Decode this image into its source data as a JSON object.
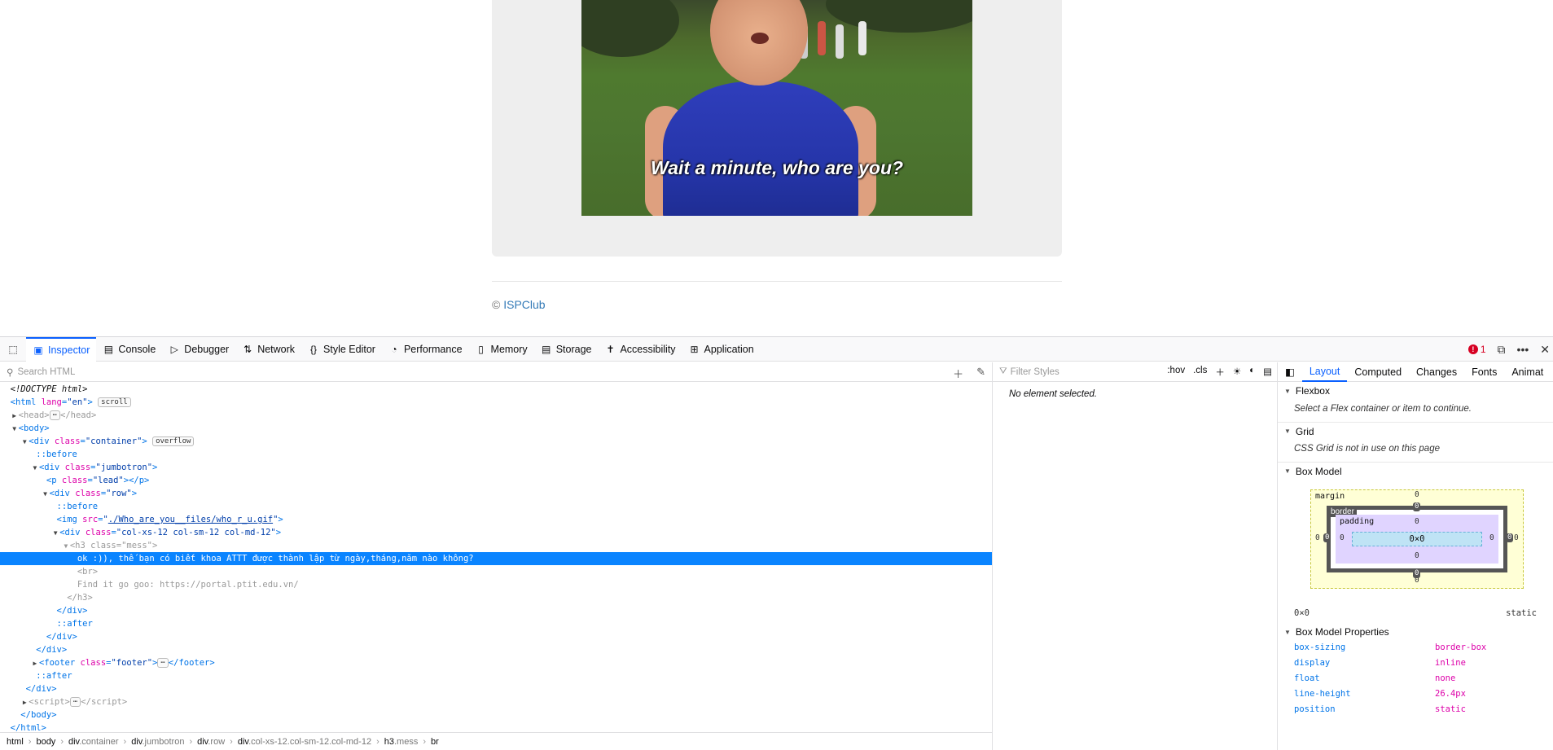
{
  "page": {
    "caption": "Wait a minute, who are you?",
    "footer_copy": "©",
    "footer_link": "ISPClub"
  },
  "devtools": {
    "tabs": [
      {
        "label": "Inspector",
        "icon": "inspector-icon"
      },
      {
        "label": "Console",
        "icon": "console-icon"
      },
      {
        "label": "Debugger",
        "icon": "debugger-icon"
      },
      {
        "label": "Network",
        "icon": "network-icon"
      },
      {
        "label": "Style Editor",
        "icon": "style-editor-icon"
      },
      {
        "label": "Performance",
        "icon": "performance-icon"
      },
      {
        "label": "Memory",
        "icon": "memory-icon"
      },
      {
        "label": "Storage",
        "icon": "storage-icon"
      },
      {
        "label": "Accessibility",
        "icon": "accessibility-icon"
      },
      {
        "label": "Application",
        "icon": "application-icon"
      }
    ],
    "error_count": "1",
    "search_placeholder": "Search HTML",
    "tree": {
      "doctype": "<!DOCTYPE html>",
      "html_lang": "\"en\"",
      "scroll_badge": "scroll",
      "overflow_badge": "overflow",
      "img_src": "./Who_are_you__files/who_r_u.gif",
      "h3_class": "\"mess\"",
      "selected_text": "ok :)), thế bạn có biết khoa ATTT được thành lập từ ngày,tháng,năm nào không?",
      "br": "<br>",
      "hint_text": "Find it go goo: https://portal.ptit.edu.vn/"
    },
    "breadcrumbs": [
      {
        "tag": "html",
        "cls": ""
      },
      {
        "tag": "body",
        "cls": ""
      },
      {
        "tag": "div",
        "cls": ".container"
      },
      {
        "tag": "div",
        "cls": ".jumbotron"
      },
      {
        "tag": "div",
        "cls": ".row"
      },
      {
        "tag": "div",
        "cls": ".col-xs-12.col-sm-12.col-md-12"
      },
      {
        "tag": "h3",
        "cls": ".mess"
      },
      {
        "tag": "br",
        "cls": ""
      }
    ],
    "rules": {
      "filter_placeholder": "Filter Styles",
      "hov": ":hov",
      "cls": ".cls",
      "empty": "No element selected."
    },
    "layout": {
      "tabs": [
        "Layout",
        "Computed",
        "Changes",
        "Fonts",
        "Animat"
      ],
      "flexbox_title": "Flexbox",
      "flexbox_note": "Select a Flex container or item to continue.",
      "grid_title": "Grid",
      "grid_note": "CSS Grid is not in use on this page",
      "boxmodel_title": "Box Model",
      "bm": {
        "margin_label": "margin",
        "border_label": "border",
        "padding_label": "padding",
        "content": "0×0",
        "zero": "0"
      },
      "size": "0×0",
      "position": "static",
      "props_title": "Box Model Properties",
      "props": [
        {
          "name": "box-sizing",
          "value": "border-box"
        },
        {
          "name": "display",
          "value": "inline"
        },
        {
          "name": "float",
          "value": "none"
        },
        {
          "name": "line-height",
          "value": "26.4px"
        },
        {
          "name": "position",
          "value": "static"
        }
      ]
    }
  }
}
